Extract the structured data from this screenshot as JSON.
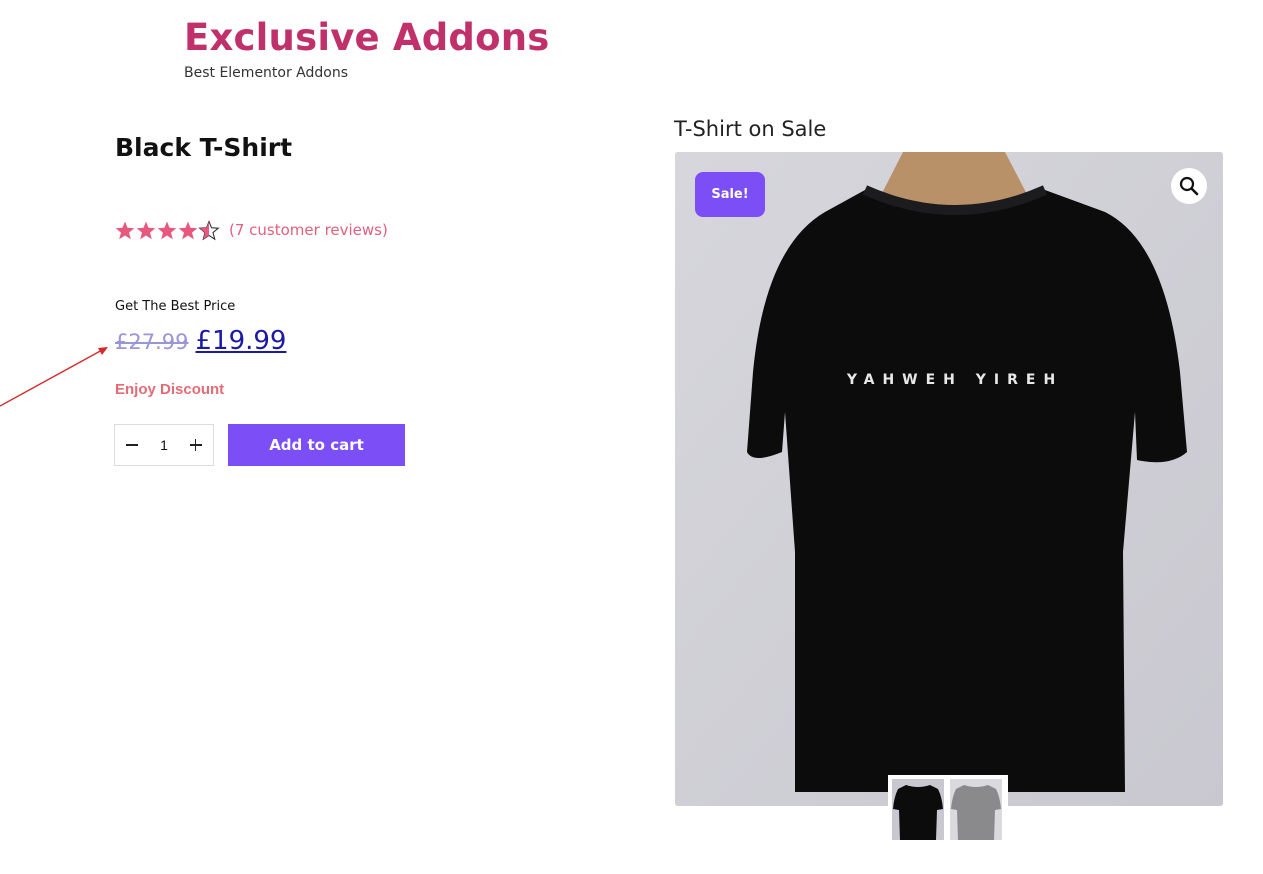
{
  "site": {
    "title": "Exclusive Addons",
    "tagline": "Best Elementor Addons"
  },
  "product": {
    "title": "Black T-Shirt",
    "rating": 4.5,
    "rating_max": 5,
    "reviews_label": "(7 customer reviews)",
    "price_label": "Get The Best Price",
    "old_price": "£27.99",
    "new_price": "£19.99",
    "discount_text": "Enjoy Discount",
    "quantity": "1",
    "add_to_cart_label": "Add to cart"
  },
  "gallery": {
    "heading": "T-Shirt on Sale",
    "sale_badge": "Sale!",
    "shirt_print": "YAHWEH YIREH",
    "thumbnails": [
      {
        "name": "black-shirt-thumb"
      },
      {
        "name": "grey-shirt-thumb"
      }
    ]
  },
  "colors": {
    "brand": "#c0306a",
    "accent": "#7b4ff5",
    "star": "#e8577e",
    "discount": "#e36b76",
    "old_price": "#9a95d8",
    "new_price": "#1a1aa6"
  },
  "icons": {
    "zoom": "search-icon",
    "minus": "minus-icon",
    "plus": "plus-icon",
    "star": "star-icon"
  }
}
